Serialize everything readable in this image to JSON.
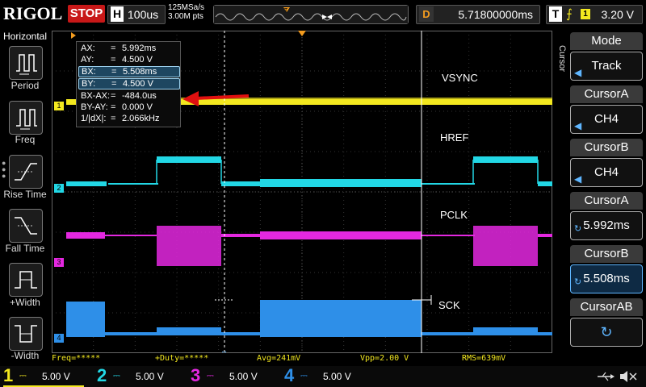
{
  "header": {
    "logo": "RIGOL",
    "run_state": "STOP",
    "timebase_label": "H",
    "timebase_value": "100us",
    "sample_rate": "125MSa/s",
    "memory_depth": "3.00M pts",
    "delay_label": "D",
    "delay_value": "5.71800000ms",
    "trigger_label": "T",
    "trigger_source": "1",
    "trigger_level": "3.20 V"
  },
  "left_menu": {
    "title": "Horizontal",
    "items": [
      {
        "label": "Period"
      },
      {
        "label": "Freq"
      },
      {
        "label": "Rise Time"
      },
      {
        "label": "Fall Time"
      },
      {
        "label": "+Width"
      },
      {
        "label": "-Width"
      }
    ]
  },
  "right_menu": {
    "side_label": "Cursor",
    "mode_title": "Mode",
    "mode_value": "Track",
    "cursora_title": "CursorA",
    "cursora_src": "CH4",
    "cursorb_title": "CursorB",
    "cursorb_src": "CH4",
    "cursora_pos_title": "CursorA",
    "cursora_pos": "5.992ms",
    "cursorb_pos_title": "CursorB",
    "cursorb_pos": "5.508ms",
    "cursorab_title": "CursorAB"
  },
  "cursor_panel": {
    "rows": [
      {
        "key": "AX:",
        "value": "5.992ms"
      },
      {
        "key": "AY:",
        "value": "4.500 V"
      },
      {
        "key": "BX:",
        "value": "5.508ms"
      },
      {
        "key": "BY:",
        "value": "4.500 V"
      },
      {
        "key": "BX-AX:",
        "value": "-484.0us"
      },
      {
        "key": "BY-AY:",
        "value": "0.000 V"
      },
      {
        "key": "1/|dX|:",
        "value": "2.066kHz"
      }
    ]
  },
  "annotations": {
    "vsync": "VSYNC",
    "href": "HREF",
    "pclk": "PCLK",
    "sck": "SCK"
  },
  "channel_markers": [
    "1",
    "2",
    "3",
    "4"
  ],
  "stats": {
    "freq": "Freq=*****",
    "duty": "+Duty=*****",
    "avg": "Avg=241mV",
    "vpp": "Vpp=2.00 V",
    "rms": "RMS=639mV"
  },
  "channels": [
    {
      "num": "1",
      "value": "5.00 V",
      "color": "#f3e81f"
    },
    {
      "num": "2",
      "value": "5.00 V",
      "color": "#22d7e5"
    },
    {
      "num": "3",
      "value": "5.00 V",
      "color": "#e428e0"
    },
    {
      "num": "4",
      "value": "5.00 V",
      "color": "#2e8fe8"
    }
  ],
  "colors": {
    "ch1": "#f3e81f",
    "ch2": "#22d7e5",
    "ch3": "#e428e0",
    "ch4": "#2e8fe8",
    "stop": "#c81818",
    "trigger_marker": "#f39c1f",
    "arrow": "#e01010"
  }
}
